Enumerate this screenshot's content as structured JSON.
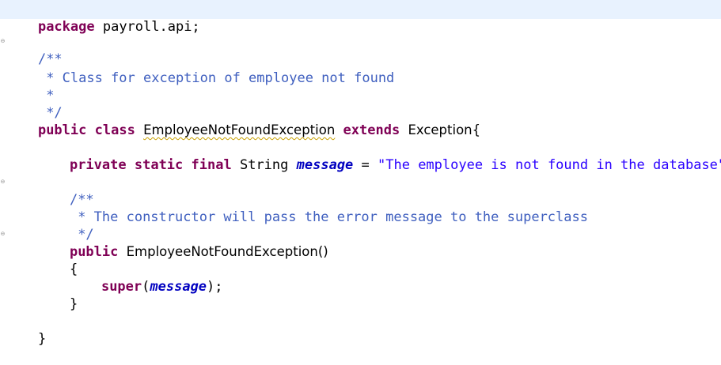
{
  "editor": {
    "language": "java",
    "fold_icon": "collapse-fold-icon",
    "lines": {
      "l1": {
        "keyword": "package",
        "rest": " payroll.api;"
      },
      "l2": {
        "open": "/**",
        "text": " * Class for exception of employee not found",
        "star": " *",
        "close": " */"
      },
      "l3": {
        "kw1": "public",
        "kw2": "class",
        "classname": "EmployeeNotFoundException",
        "kw3": "extends",
        "superclass": "Exception{"
      },
      "l4": {
        "kw1": "private",
        "kw2": "static",
        "kw3": "final",
        "type": "String",
        "field": "message",
        "eq": " = ",
        "value": "\"The employee is not found in the database\"",
        "semi": ";"
      },
      "l5": {
        "open": "/**",
        "text": " * The constructor will pass the error message to the superclass",
        "close": " */"
      },
      "l6": {
        "kw": "public",
        "sig": "EmployeeNotFoundException()"
      },
      "l7": {
        "open_brace": "{"
      },
      "l8": {
        "kw": "super",
        "paren_open": "(",
        "field": "message",
        "paren_close": ");"
      },
      "l9": {
        "close_brace": "}"
      },
      "l10": {
        "close_brace": "}"
      }
    }
  }
}
